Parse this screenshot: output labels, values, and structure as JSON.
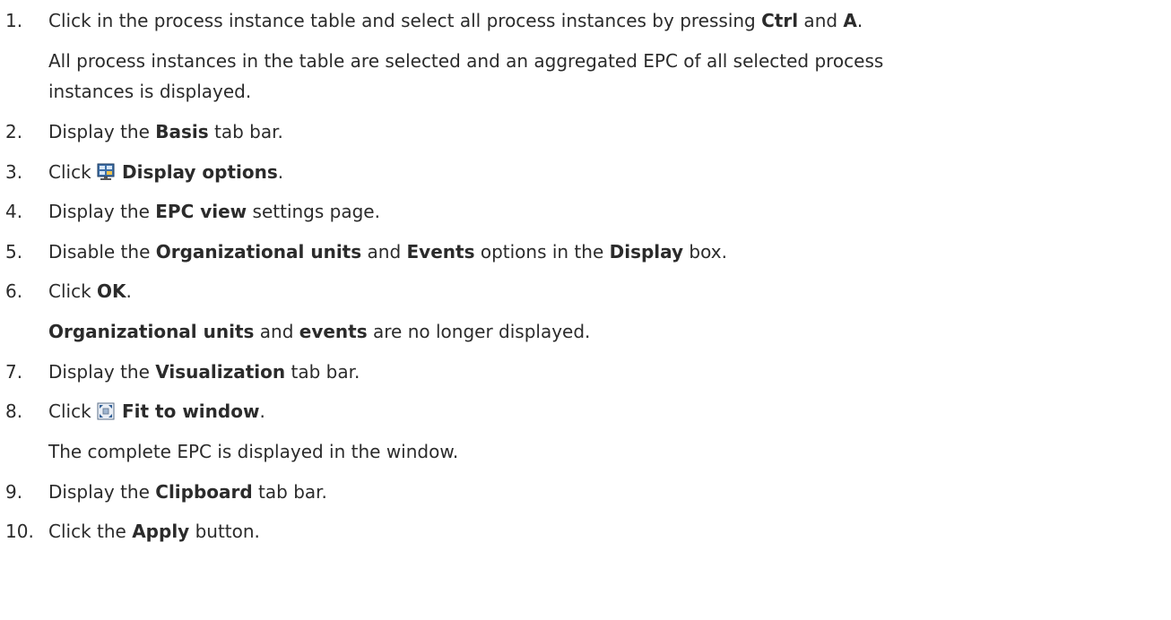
{
  "steps": [
    {
      "num": "1.",
      "parts": [
        "Click in the process instance table and select all process instances by pressing ",
        "Ctrl",
        " and ",
        "A",
        "."
      ],
      "result_line1": "All process instances in the table are selected and an aggregated EPC of all selected process",
      "result_line2": "instances is displayed."
    },
    {
      "num": "2.",
      "parts": [
        "Display the ",
        "Basis",
        " tab bar."
      ]
    },
    {
      "num": "3.",
      "parts": [
        "Click ",
        "Display options",
        "."
      ],
      "icon": "display-options-icon"
    },
    {
      "num": "4.",
      "parts": [
        "Display the ",
        "EPC view",
        " settings page."
      ]
    },
    {
      "num": "5.",
      "parts": [
        "Disable the ",
        "Organizational units",
        " and ",
        "Events",
        " options in the ",
        "Display",
        " box."
      ]
    },
    {
      "num": "6.",
      "parts": [
        "Click ",
        "OK",
        "."
      ],
      "result_parts": [
        "Organizational units",
        " and ",
        "events",
        " are no longer displayed."
      ]
    },
    {
      "num": "7.",
      "parts": [
        "Display the ",
        "Visualization",
        " tab bar."
      ]
    },
    {
      "num": "8.",
      "parts": [
        "Click ",
        "Fit to window",
        "."
      ],
      "icon": "fit-to-window-icon",
      "result_line1": "The complete EPC is displayed in the window."
    },
    {
      "num": "9.",
      "parts": [
        "Display the ",
        "Clipboard",
        " tab bar."
      ]
    },
    {
      "num": "10.",
      "parts": [
        "Click the ",
        "Apply",
        " button."
      ]
    }
  ]
}
